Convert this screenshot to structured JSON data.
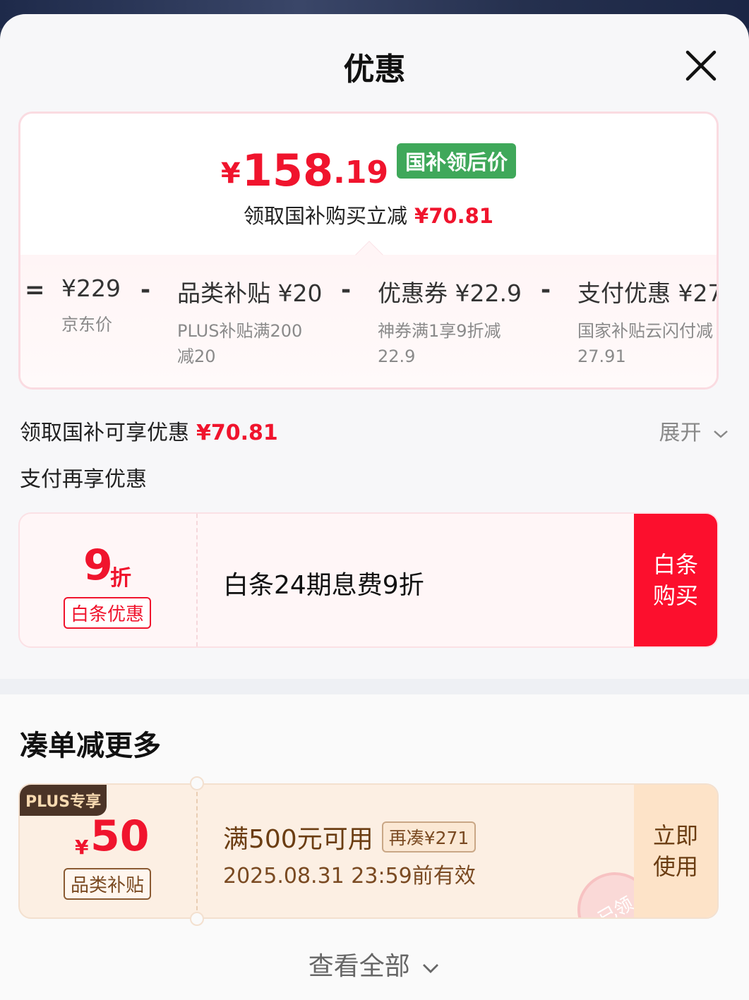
{
  "header": {
    "title": "优惠"
  },
  "price": {
    "symbol": "¥",
    "integer": "158",
    "decimal": ".19",
    "tag": "国补领后价",
    "save_text": "领取国补购买立减",
    "save_amount": "¥70.81"
  },
  "breakdown": [
    {
      "op": "=",
      "main": "¥229",
      "sub1": "京东价",
      "sub2": ""
    },
    {
      "op": "-",
      "main": "品类补贴 ¥20",
      "sub1": "PLUS补贴满200",
      "sub2": "减20"
    },
    {
      "op": "-",
      "main": "优惠券 ¥22.9",
      "sub1": "神券满1享9折减",
      "sub2": "22.9"
    },
    {
      "op": "-",
      "main": "支付优惠 ¥27",
      "sub1": "国家补贴云闪付减",
      "sub2": "27.91"
    }
  ],
  "summary": {
    "label": "领取国补可享优惠",
    "amount": "¥70.81",
    "expand": "展开"
  },
  "pay_section": {
    "label": "支付再享优惠",
    "discount": "9",
    "discount_unit": "折",
    "tag": "白条优惠",
    "title": "白条24期息费9折",
    "button_line1": "白条",
    "button_line2": "购买"
  },
  "bundle": {
    "title": "凑单减更多",
    "coupon": {
      "badge": "PLUS专享",
      "symbol": "¥",
      "amount": "50",
      "tag": "品类补贴",
      "condition": "满500元可用",
      "extra": "再凑¥271",
      "validity": "2025.08.31 23:59前有效",
      "button_line1": "立即",
      "button_line2": "使用",
      "stamp": "已领"
    },
    "view_all": "查看全部"
  },
  "colors": {
    "accent_red": "#f0142d",
    "tag_green": "#3fa85a",
    "coupon_brown": "#6b3d12"
  }
}
